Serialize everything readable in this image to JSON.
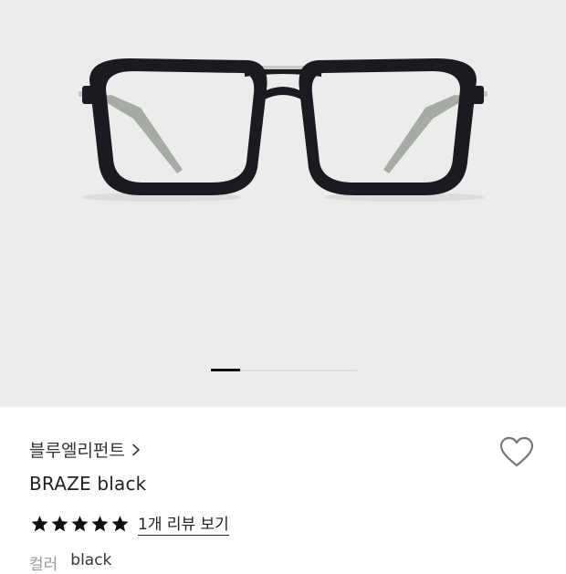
{
  "product": {
    "brand": "블루엘리펀트",
    "name": "BRAZE black",
    "rating_stars": 5,
    "review_link": "1개 리뷰 보기",
    "color_label": "컬러",
    "color_value": "black"
  },
  "gallery": {
    "current_index": 1,
    "total": 5
  },
  "icons": {
    "brand_chevron": "chevron-right-icon",
    "wishlist": "heart-icon",
    "star": "star-icon"
  },
  "colors": {
    "hero_bg": "#ececec",
    "star": "#111111",
    "frame": "#1a1b20"
  }
}
